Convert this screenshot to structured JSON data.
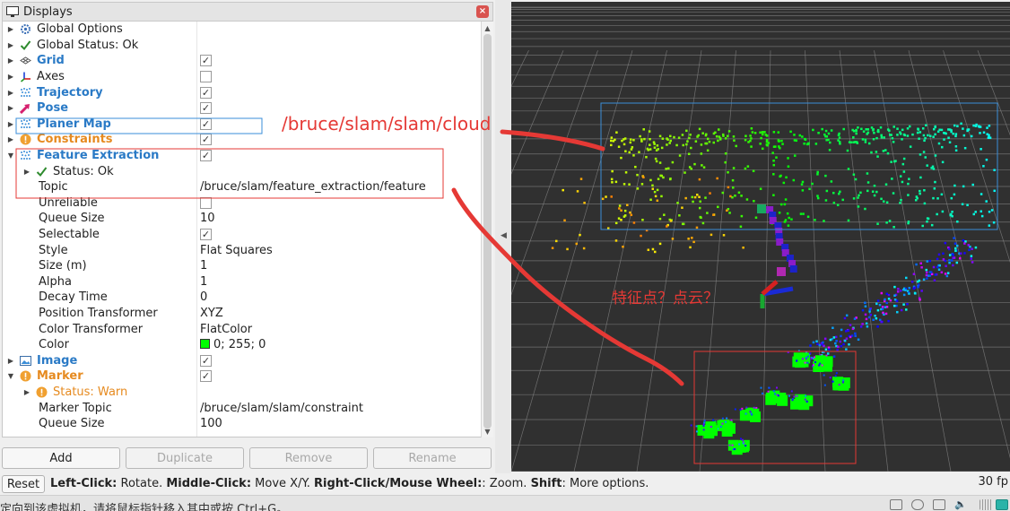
{
  "panel": {
    "title": "Displays",
    "close_symbol": "×"
  },
  "rows": [
    {
      "indent": 0,
      "arrow": "right",
      "icon": "gear-icon",
      "name": "Global Options",
      "style": "plain"
    },
    {
      "indent": 0,
      "arrow": "right",
      "icon": "check-icon",
      "name": "Global Status: Ok",
      "style": "plain"
    },
    {
      "indent": 0,
      "arrow": "right",
      "icon": "grid-icon",
      "name": "Grid",
      "style": "blue",
      "checkbox": true
    },
    {
      "indent": 0,
      "arrow": "right",
      "icon": "axes-icon",
      "name": "Axes",
      "style": "plain",
      "checkbox": false
    },
    {
      "indent": 0,
      "arrow": "right",
      "icon": "pointcloud-icon",
      "name": "Trajectory",
      "style": "blue",
      "checkbox": true
    },
    {
      "indent": 0,
      "arrow": "right",
      "icon": "pose-arrow-icon",
      "name": "Pose",
      "style": "blue",
      "checkbox": true
    },
    {
      "indent": 0,
      "arrow": "right",
      "icon": "pointcloud-icon",
      "name": "Planer Map",
      "style": "blue",
      "checkbox": true
    },
    {
      "indent": 0,
      "arrow": "right",
      "icon": "warning-icon",
      "name": "Constraints",
      "style": "orange",
      "checkbox": true
    },
    {
      "indent": 0,
      "arrow": "down",
      "icon": "pointcloud-icon",
      "name": "Feature Extraction",
      "style": "blue",
      "checkbox": true
    },
    {
      "indent": 1,
      "arrow": "right",
      "icon": "check-icon",
      "name": "Status: Ok",
      "style": "plain"
    },
    {
      "indent": 1,
      "arrow": "",
      "icon": "",
      "name": "Topic",
      "style": "plain",
      "value": "/bruce/slam/feature_extraction/feature"
    },
    {
      "indent": 1,
      "arrow": "",
      "icon": "",
      "name": "Unreliable",
      "style": "plain",
      "checkbox": false
    },
    {
      "indent": 1,
      "arrow": "",
      "icon": "",
      "name": "Queue Size",
      "style": "plain",
      "value": "10"
    },
    {
      "indent": 1,
      "arrow": "",
      "icon": "",
      "name": "Selectable",
      "style": "plain",
      "checkbox": true
    },
    {
      "indent": 1,
      "arrow": "",
      "icon": "",
      "name": "Style",
      "style": "plain",
      "value": "Flat Squares"
    },
    {
      "indent": 1,
      "arrow": "",
      "icon": "",
      "name": "Size (m)",
      "style": "plain",
      "value": "1"
    },
    {
      "indent": 1,
      "arrow": "",
      "icon": "",
      "name": "Alpha",
      "style": "plain",
      "value": "1"
    },
    {
      "indent": 1,
      "arrow": "",
      "icon": "",
      "name": "Decay Time",
      "style": "plain",
      "value": "0"
    },
    {
      "indent": 1,
      "arrow": "",
      "icon": "",
      "name": "Position Transformer",
      "style": "plain",
      "value": "XYZ"
    },
    {
      "indent": 1,
      "arrow": "",
      "icon": "",
      "name": "Color Transformer",
      "style": "plain",
      "value": "FlatColor"
    },
    {
      "indent": 1,
      "arrow": "",
      "icon": "",
      "name": "Color",
      "style": "plain",
      "value": "0; 255; 0",
      "swatch": "#00ff00"
    },
    {
      "indent": 0,
      "arrow": "right",
      "icon": "image-icon",
      "name": "Image",
      "style": "blue",
      "checkbox": true
    },
    {
      "indent": 0,
      "arrow": "down",
      "icon": "warning-icon",
      "name": "Marker",
      "style": "orange",
      "checkbox": true
    },
    {
      "indent": 1,
      "arrow": "right",
      "icon": "warning-icon",
      "name": "Status: Warn",
      "style": "orange-plain"
    },
    {
      "indent": 1,
      "arrow": "",
      "icon": "",
      "name": "Marker Topic",
      "style": "plain",
      "value": "/bruce/slam/slam/constraint"
    },
    {
      "indent": 1,
      "arrow": "",
      "icon": "",
      "name": "Queue Size",
      "style": "plain",
      "value": "100"
    }
  ],
  "buttons": {
    "add": "Add",
    "duplicate": "Duplicate",
    "remove": "Remove",
    "rename": "Rename"
  },
  "statusbar": {
    "reset": "Reset",
    "hint_parts": [
      {
        "bold": true,
        "text": "Left-Click:"
      },
      {
        "bold": false,
        "text": " Rotate. "
      },
      {
        "bold": true,
        "text": "Middle-Click:"
      },
      {
        "bold": false,
        "text": " Move X/Y. "
      },
      {
        "bold": true,
        "text": "Right-Click/Mouse Wheel:"
      },
      {
        "bold": false,
        "text": ": Zoom. "
      },
      {
        "bold": true,
        "text": "Shift"
      },
      {
        "bold": false,
        "text": ": More options."
      }
    ],
    "fps": "30 fp"
  },
  "vmbar": {
    "text": "定向到该虚拟机，请将鼠标指针移入其中或按 Ctrl+G。"
  },
  "annotations": {
    "cloud_topic": "/bruce/slam/slam/cloud",
    "feature_question": "特征点？点云？"
  },
  "colors": {
    "blue_label": "#2a7ac6",
    "orange_label": "#e68a1f",
    "annotation_red": "#e53935",
    "feature_green": "#00ff00",
    "viewport_bg": "#303030"
  }
}
